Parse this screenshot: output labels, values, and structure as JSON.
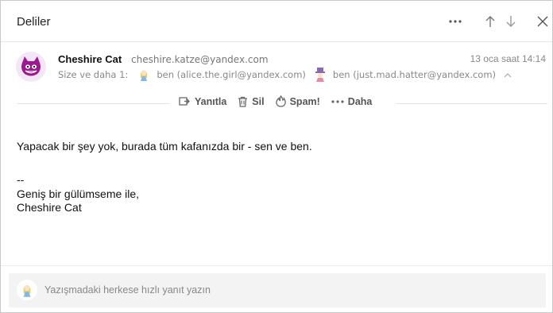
{
  "header": {
    "subject": "Deliler",
    "icons": [
      "more-icon",
      "arrow-up-icon",
      "arrow-down-icon",
      "close-icon"
    ]
  },
  "message": {
    "sender_name": "Cheshire Cat",
    "sender_email": "cheshire.katze@yandex.com",
    "date": "13 oca saat 14:14",
    "recipients_label": "Size ve daha 1:",
    "recipients": [
      {
        "label": "ben (alice.the.girl@yandex.com)",
        "avatar": "alice-avatar"
      },
      {
        "label": "ben (just.mad.hatter@yandex.com)",
        "avatar": "hatter-avatar"
      }
    ]
  },
  "actions": {
    "reply": "Yanıtla",
    "delete": "Sil",
    "spam": "Spam!",
    "more": "Daha"
  },
  "body": {
    "line1": "Yapacak bir şey yok, burada tüm kafanızda bir - sen ve ben.",
    "sig_dashes": "--",
    "sig_line1": "Geniş bir gülümseme ile,",
    "sig_line2": "Cheshire Cat"
  },
  "quick_reply": {
    "placeholder": "Yazışmadaki herkese hızlı yanıt yazın"
  },
  "colors": {
    "accent_avatar": "#9b1a8f",
    "muted_text": "#888888",
    "divider": "#e3e3e3"
  }
}
